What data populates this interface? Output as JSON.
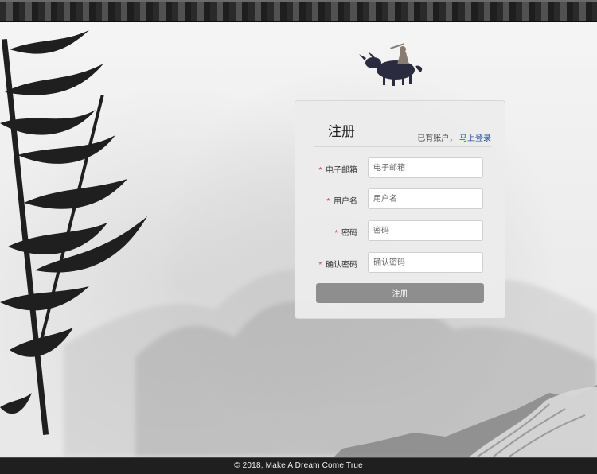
{
  "panel": {
    "title": "注册",
    "login_prompt_prefix": "已有账户，",
    "login_link": "马上登录"
  },
  "form": {
    "required_mark": "*",
    "fields": [
      {
        "label": "电子邮箱",
        "placeholder": "电子邮箱"
      },
      {
        "label": "用户名",
        "placeholder": "用户名"
      },
      {
        "label": "密码",
        "placeholder": "密码"
      },
      {
        "label": "确认密码",
        "placeholder": "确认密码"
      }
    ],
    "submit_label": "注册"
  },
  "footer": {
    "text": "© 2018, Make A Dream Come True"
  },
  "theme": {
    "button_color": "#8e8e8e",
    "link_color": "#2b4f99",
    "required_color": "#d53d3d"
  },
  "decorations": {
    "ink_scene": "ink-wash-mountains",
    "bamboo_icon": "bamboo-icon",
    "ox_icon": "ox-rider-icon"
  }
}
